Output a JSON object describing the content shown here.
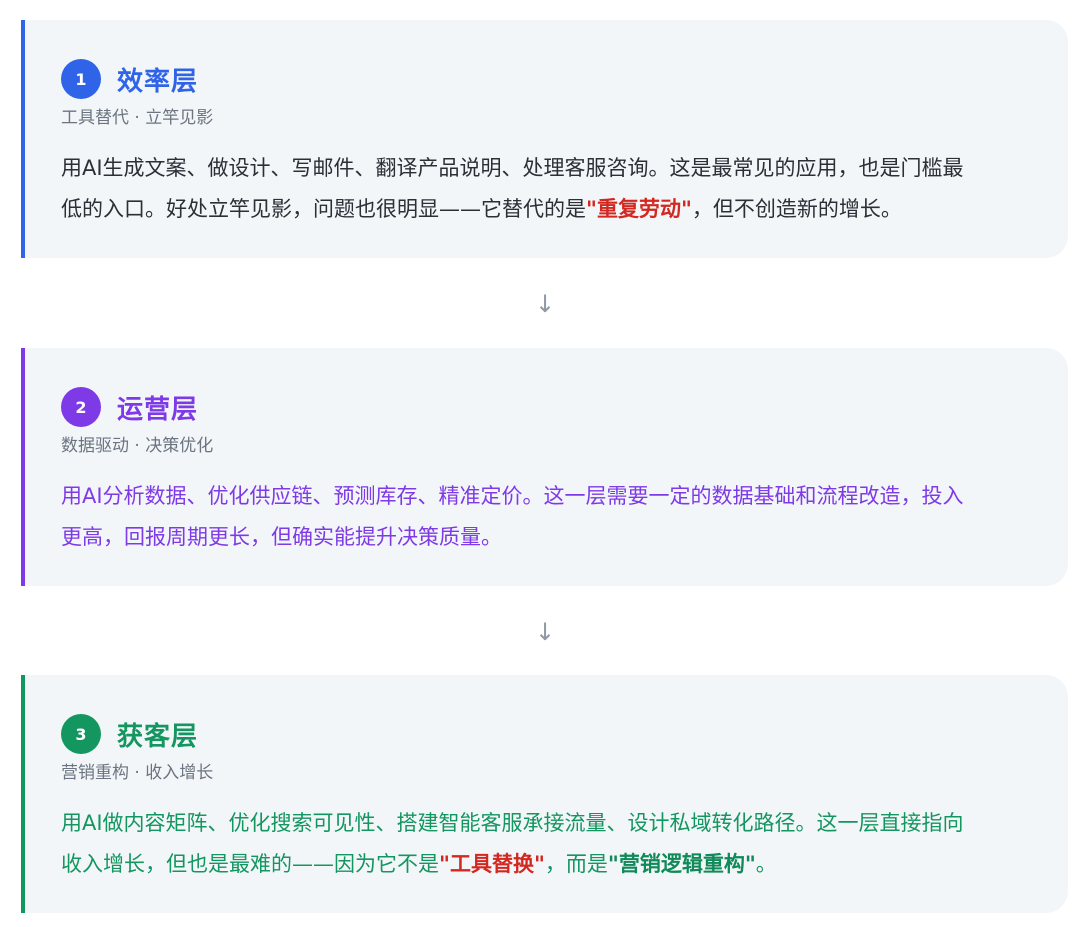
{
  "layers": [
    {
      "number": "1",
      "title": "效率层",
      "subtitle": "工具替代 · 立竿见影",
      "body": {
        "line1": "用AI生成文案、做设计、写邮件、翻译产品说明、处理客服咨询。这是最常见的应用，也是门槛最",
        "line2_before": "低的入口。好处立竿见影，问题也很明显——它替代的是",
        "highlight": "\"重复劳动\"",
        "line2_after": "，但不创造新的增长。"
      },
      "accent_color": "#2f64e8"
    },
    {
      "number": "2",
      "title": "运营层",
      "subtitle": "数据驱动 · 决策优化",
      "body": {
        "line1": "用AI分析数据、优化供应链、预测库存、精准定价。这一层需要一定的数据基础和流程改造，投入",
        "line2": "更高，回报周期更长，但确实能提升决策质量。"
      },
      "accent_color": "#7e3ae6"
    },
    {
      "number": "3",
      "title": "获客层",
      "subtitle": "营销重构 · 收入增长",
      "body": {
        "line1": "用AI做内容矩阵、优化搜索可见性、搭建智能客服承接流量、设计私域转化路径。这一层直接指向",
        "line2_before": "收入增长，但也是最难的——因为它不是",
        "highlight1": "\"工具替换\"",
        "line2_mid": "，而是",
        "highlight2": "\"营销逻辑重构\"",
        "line2_after": "。"
      },
      "accent_color": "#139660"
    }
  ],
  "arrows": [
    "↓",
    "↓"
  ],
  "colors": {
    "highlight_red": "#d2281f",
    "highlight_green": "#0f8a58",
    "card_background": "#f3f6f9"
  }
}
